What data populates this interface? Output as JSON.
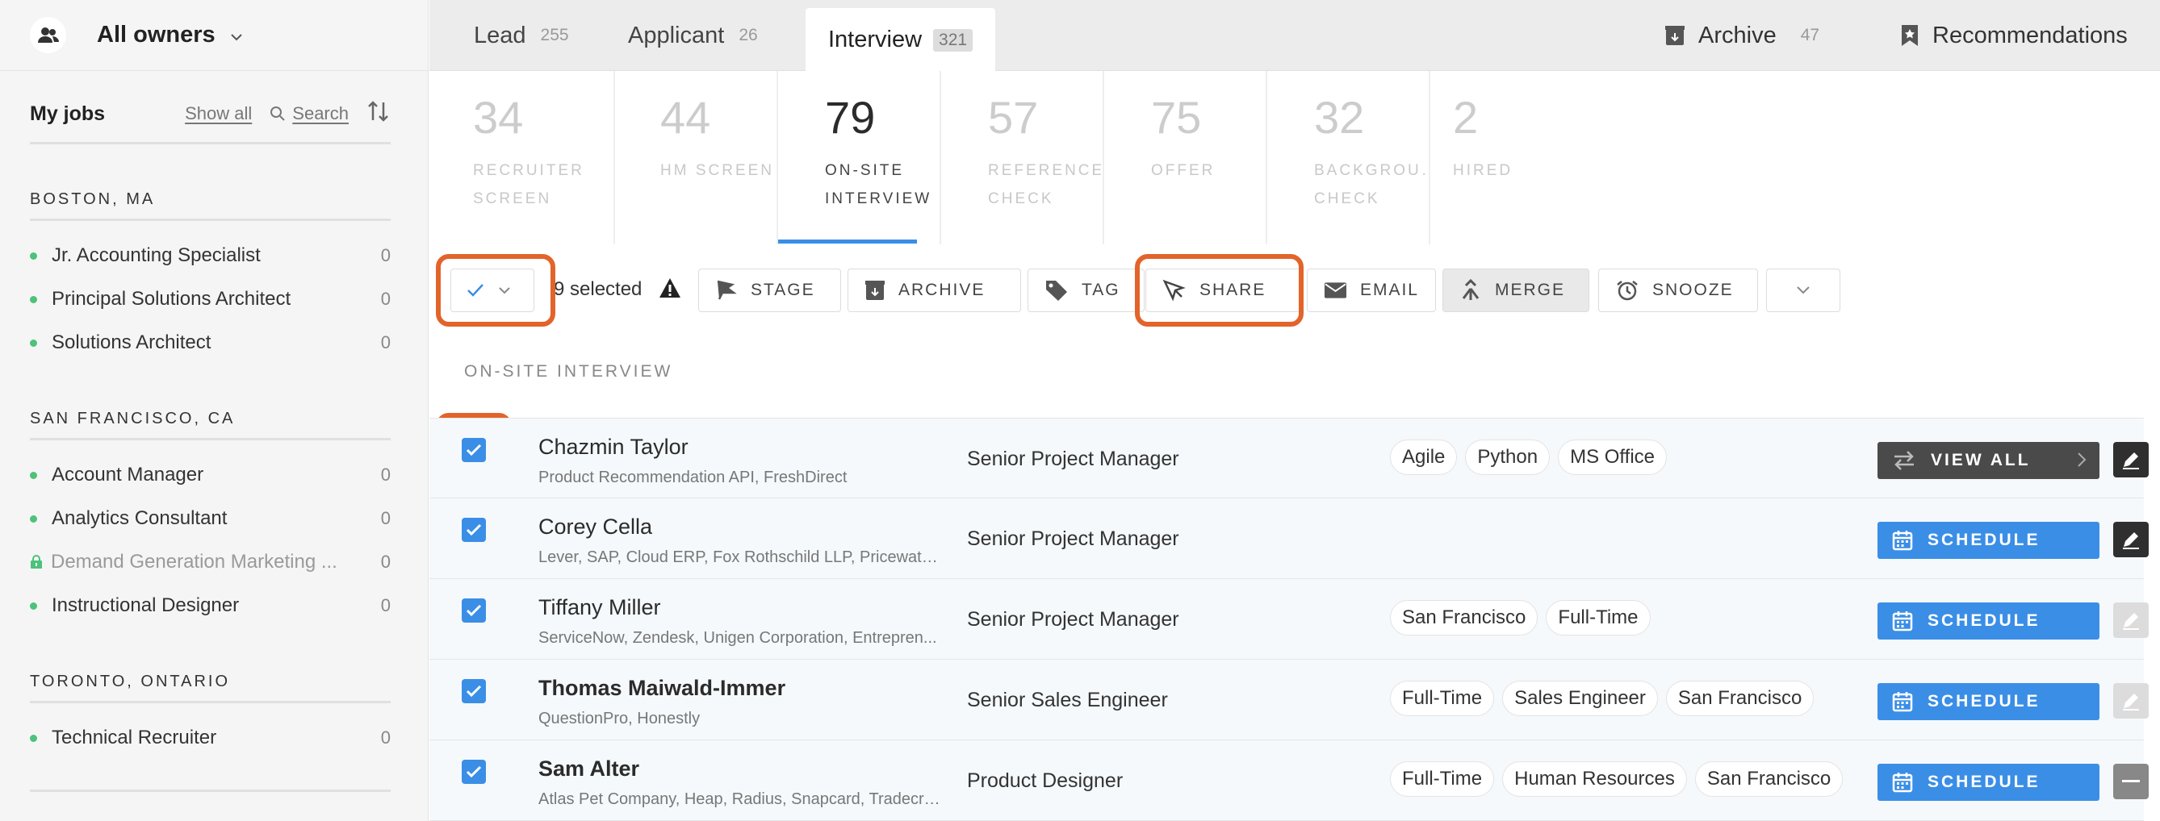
{
  "owner": {
    "label": "All owners"
  },
  "myjobs": {
    "title": "My jobs",
    "show_all": "Show all",
    "search": "Search"
  },
  "locations": [
    {
      "name": "BOSTON, MA",
      "jobs": [
        {
          "name": "Jr. Accounting Specialist",
          "count": "0",
          "locked": false
        },
        {
          "name": "Principal Solutions Architect",
          "count": "0",
          "locked": false
        },
        {
          "name": "Solutions Architect",
          "count": "0",
          "locked": false
        }
      ]
    },
    {
      "name": "SAN FRANCISCO, CA",
      "jobs": [
        {
          "name": "Account Manager",
          "count": "0",
          "locked": false
        },
        {
          "name": "Analytics Consultant",
          "count": "0",
          "locked": false
        },
        {
          "name": "Demand Generation Marketing ...",
          "count": "0",
          "locked": true
        },
        {
          "name": "Instructional Designer",
          "count": "0",
          "locked": false
        }
      ]
    },
    {
      "name": "TORONTO, ONTARIO",
      "jobs": [
        {
          "name": "Technical Recruiter",
          "count": "0",
          "locked": false
        }
      ]
    }
  ],
  "tabs": [
    {
      "label": "Lead",
      "count": "255"
    },
    {
      "label": "Applicant",
      "count": "26"
    },
    {
      "label": "Interview",
      "count": "321"
    }
  ],
  "right_tabs": {
    "archive": {
      "label": "Archive",
      "count": "47"
    },
    "recommendations": {
      "label": "Recommendations"
    }
  },
  "stages": [
    {
      "num": "34",
      "label": "RECRUITER SCREEN"
    },
    {
      "num": "44",
      "label": "HM SCREEN"
    },
    {
      "num": "79",
      "label": "ON-SITE INTERVIEW"
    },
    {
      "num": "57",
      "label": "REFERENCE CHECK"
    },
    {
      "num": "75",
      "label": "OFFER"
    },
    {
      "num": "32",
      "label": "BACKGROU… CHECK"
    },
    {
      "num": "2",
      "label": "HIRED"
    }
  ],
  "toolbar": {
    "selected": "9 selected",
    "stage": "STAGE",
    "archive": "ARCHIVE",
    "tag": "TAG",
    "share": "SHARE",
    "email": "EMAIL",
    "merge": "MERGE",
    "snooze": "SNOOZE"
  },
  "section_title": "ON-SITE INTERVIEW",
  "candidates": [
    {
      "name": "Chazmin Taylor",
      "bold": false,
      "sub": "Product Recommendation API, FreshDirect",
      "position": "Senior Project Manager",
      "tags": [
        "Agile",
        "Python",
        "MS Office"
      ],
      "action": "VIEW ALL"
    },
    {
      "name": "Corey Cella",
      "bold": false,
      "sub": "Lever, SAP, Cloud ERP, Fox Rothschild LLP, Pricewaterh...",
      "position": "Senior Project Manager",
      "tags": [],
      "action": "SCHEDULE"
    },
    {
      "name": "Tiffany Miller",
      "bold": false,
      "sub": "ServiceNow, Zendesk, Unigen Corporation, Entrepren...",
      "position": "Senior Project Manager",
      "tags": [
        "San Francisco",
        "Full-Time"
      ],
      "action": "SCHEDULE"
    },
    {
      "name": "Thomas Maiwald-Immer",
      "bold": true,
      "sub": "QuestionPro, Honestly",
      "position": "Senior Sales Engineer",
      "tags": [
        "Full-Time",
        "Sales Engineer",
        "San Francisco"
      ],
      "action": "SCHEDULE"
    },
    {
      "name": "Sam Alter",
      "bold": true,
      "sub": "Atlas Pet Company, Heap, Radius, Snapcard, Tradecra...",
      "position": "Product Designer",
      "tags": [
        "Full-Time",
        "Human Resources",
        "San Francisco"
      ],
      "action": "SCHEDULE"
    }
  ]
}
